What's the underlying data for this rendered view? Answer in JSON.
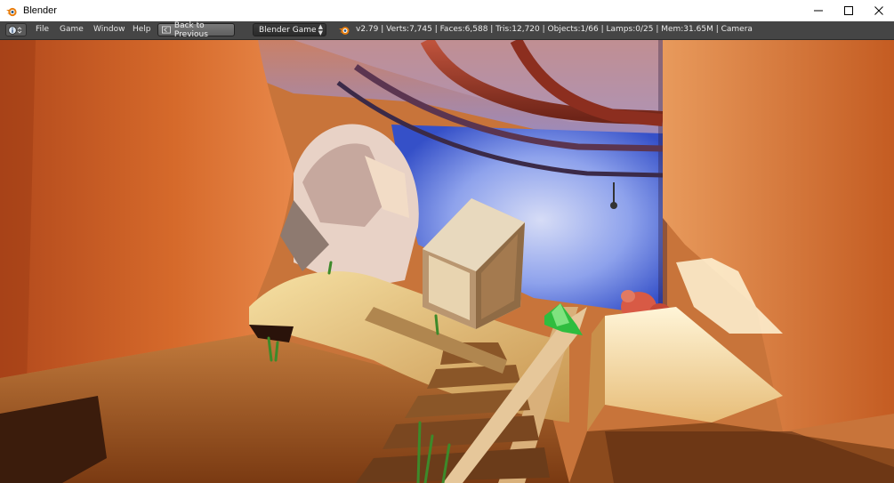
{
  "window": {
    "title": "Blender",
    "controls": [
      "minimize",
      "maximize",
      "close"
    ]
  },
  "infobar": {
    "editor_type_icon": "info-icon",
    "menus": [
      {
        "label": "File"
      },
      {
        "label": "Game"
      },
      {
        "label": "Window"
      },
      {
        "label": "Help"
      }
    ],
    "back_button": {
      "label": "Back to Previous",
      "icon": "screen-back-icon"
    },
    "render_engine": {
      "selected": "Blender Game"
    },
    "stats": "v2.79 | Verts:7,745 | Faces:6,588 | Tris:12,720 | Objects:1/66 | Lamps:0/25 | Mem:31.65M | Camera"
  },
  "viewport": {
    "scene": "game-engine-3d-scene",
    "objects": [
      "cave-walls",
      "wooden-crate",
      "rail-track",
      "green-crystal",
      "red-creature",
      "overhead-pipes",
      "grass-tufts"
    ]
  },
  "colors": {
    "titlebar_bg": "#ffffff",
    "infobar_bg": "#454545",
    "blender_orange": "#e87d0d"
  }
}
